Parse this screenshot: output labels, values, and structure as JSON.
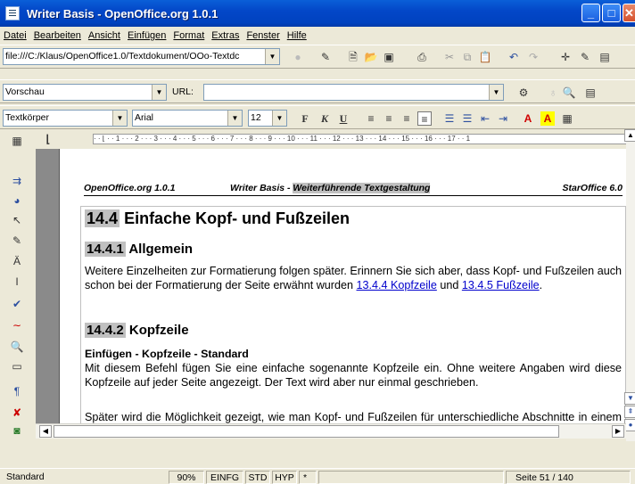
{
  "window": {
    "title": "Writer Basis - OpenOffice.org 1.0.1"
  },
  "menu": [
    "Datei",
    "Bearbeiten",
    "Ansicht",
    "Einfügen",
    "Format",
    "Extras",
    "Fenster",
    "Hilfe"
  ],
  "function_bar": {
    "url": "file:///C:/Klaus/OpenOffice1.0/Textdokument/OOo-Textdc"
  },
  "hyperlink_bar": {
    "frame": "Vorschau",
    "url_label": "URL:",
    "url_value": ""
  },
  "object_bar": {
    "style": "Textkörper",
    "font": "Arial",
    "size": "12",
    "bold": "F",
    "italic": "K",
    "underline": "U"
  },
  "ruler": {
    "text": "· · ⌊ · · 1 · · · 2 · · · 3 · · · 4 · · · 5 · · · 6 · · · 7 · · · 8 · · · 9 · · · 10 · · · 11 · · · 12 · · · 13 · · · 14 · · · 15 · · · 16 · · · 17 · · 1"
  },
  "page_header": {
    "left": "OpenOffice.org 1.0.1",
    "center": "Writer Basis - ",
    "center_bold": "Weiterführende Textgestaltung",
    "right": "StarOffice 6.0"
  },
  "doc": {
    "h1_num": "14.4",
    "h1_text": "Einfache Kopf- und Fußzeilen",
    "h2a_num": "14.4.1",
    "h2a_text": "Allgemein",
    "p1_a": "Weitere Einzelheiten zur Formatierung folgen später. Erinnern Sie sich aber, dass Kopf- und Fußzeilen auch schon bei der Formatierung der Seite erwähnt wurden ",
    "p1_link1": "13.4.4 Kopfzeile",
    "p1_mid": " und ",
    "p1_link2": "13.4.5 Fußzeile",
    "p1_end": ".",
    "h2b_num": "14.4.2",
    "h2b_text": "Kopfzeile",
    "sub": "Einfügen - Kopfzeile - Standard",
    "p2": "Mit diesem Befehl fügen Sie eine einfache sogenannte Kopfzeile ein. Ohne weitere Angaben wird diese Kopfzeile auf jeder Seite angezeigt. Der Text wird aber nur einmal geschrieben.",
    "p3": "Später wird die Möglichkeit gezeigt, wie man Kopf- und Fußzeilen für unterschiedliche Abschnitte in einem Dokument festlegen kann oder wie dort ein Bild oder Logo platziert werden kann."
  },
  "status": {
    "style": "Standard",
    "zoom": "90%",
    "insert": "EINFG",
    "std": "STD",
    "hyp": "HYP",
    "mod": "*",
    "page": "Seite 51 / 140"
  }
}
